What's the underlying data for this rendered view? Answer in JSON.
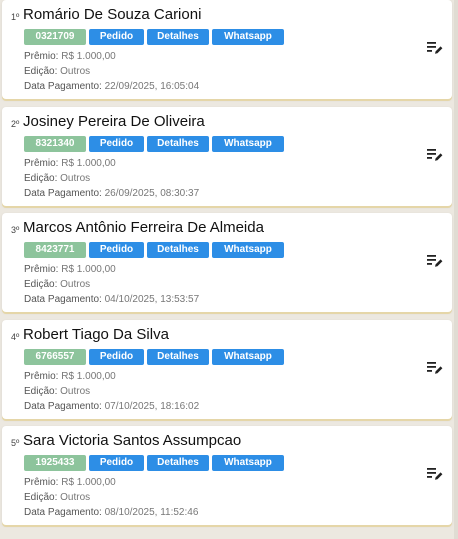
{
  "labels": {
    "premio": "Prêmio:",
    "edicao": "Edição:",
    "data_pagamento": "Data Pagamento:"
  },
  "entries": [
    {
      "rank": "1º",
      "name": "Romário De Souza Carioni",
      "code": "0321709",
      "buttons": [
        "Pedido",
        "Detalhes",
        "Whatsapp"
      ],
      "premio": "R$ 1.000,00",
      "edicao": "Outros",
      "data_pagamento": "22/09/2025, 16:05:04",
      "icon": "edit-list-icon"
    },
    {
      "rank": "2º",
      "name": "Josiney Pereira De Oliveira",
      "code": "8321340",
      "buttons": [
        "Pedido",
        "Detalhes",
        "Whatsapp"
      ],
      "premio": "R$ 1.000,00",
      "edicao": "Outros",
      "data_pagamento": "26/09/2025, 08:30:37",
      "icon": "edit-list-icon"
    },
    {
      "rank": "3º",
      "name": "Marcos Antônio Ferreira De Almeida",
      "code": "8423771",
      "buttons": [
        "Pedido",
        "Detalhes",
        "Whatsapp"
      ],
      "premio": "R$ 1.000,00",
      "edicao": "Outros",
      "data_pagamento": "04/10/2025, 13:53:57",
      "icon": "edit-list-icon"
    },
    {
      "rank": "4º",
      "name": "Robert Tiago Da Silva",
      "code": "6766557",
      "buttons": [
        "Pedido",
        "Detalhes",
        "Whatsapp"
      ],
      "premio": "R$ 1.000,00",
      "edicao": "Outros",
      "data_pagamento": "07/10/2025, 18:16:02",
      "icon": "edit-list-icon"
    },
    {
      "rank": "5º",
      "name": "Sara Victoria Santos Assumpcao",
      "code": "1925433",
      "buttons": [
        "Pedido",
        "Detalhes",
        "Whatsapp"
      ],
      "premio": "R$ 1.000,00",
      "edicao": "Outros",
      "data_pagamento": "08/10/2025, 11:52:46",
      "icon": "edit-list-icon"
    }
  ],
  "colors": {
    "page_background": "#ece8e0",
    "code_badge": "#8dc49c",
    "button": "#2d8ee6",
    "card_accent": "#e5d6a8"
  }
}
